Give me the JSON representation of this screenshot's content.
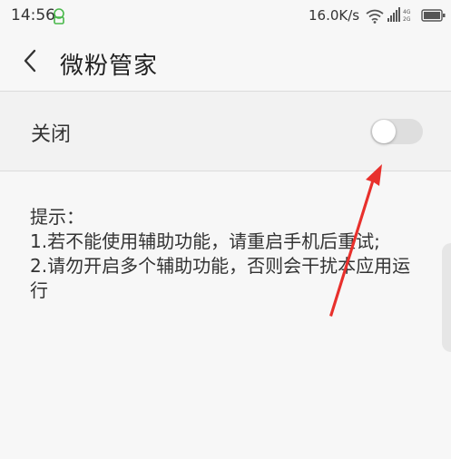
{
  "status_bar": {
    "time": "14:56",
    "network_speed": "16.0K/s",
    "icons": [
      "notification-icon",
      "wifi-icon",
      "signal-icon",
      "battery-icon"
    ]
  },
  "header": {
    "back_icon": "chevron-left-icon",
    "title": "微粉管家"
  },
  "setting": {
    "label": "关闭",
    "toggle_on": false
  },
  "tips": {
    "heading": "提示：",
    "line1": "1.若不能使用辅助功能，请重启手机后重试;",
    "line2": "2.请勿开启多个辅助功能，否则会干扰本应用运行"
  },
  "colors": {
    "background": "#f7f7f7",
    "toggle_track": "#dedede",
    "annotation_arrow": "#e8302c"
  }
}
